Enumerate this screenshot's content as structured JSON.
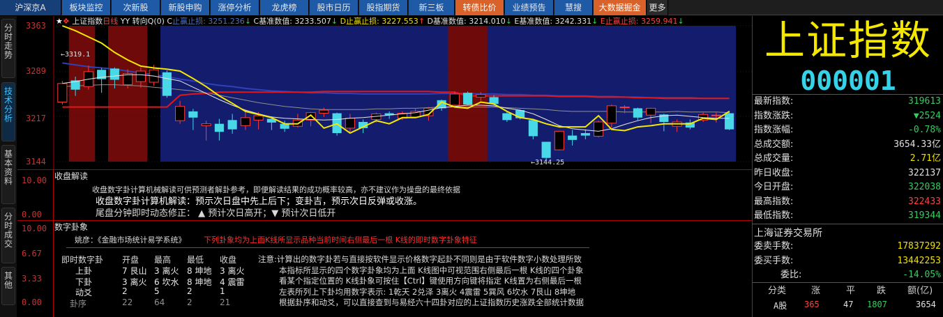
{
  "topbar": {
    "tabs": [
      {
        "label": "沪深京A",
        "style": "first"
      },
      {
        "label": "板块监控",
        "style": ""
      },
      {
        "label": "次新股",
        "style": ""
      },
      {
        "label": "新股申购",
        "style": ""
      },
      {
        "label": "涨停分析",
        "style": ""
      },
      {
        "label": "龙虎榜",
        "style": ""
      },
      {
        "label": "股市日历",
        "style": ""
      },
      {
        "label": "股指期货",
        "style": ""
      },
      {
        "label": "新三板",
        "style": ""
      },
      {
        "label": "转债比价",
        "style": "orange"
      },
      {
        "label": "业绩预告",
        "style": ""
      },
      {
        "label": "慧搜",
        "style": ""
      },
      {
        "label": "大数据掘金",
        "style": "orange"
      },
      {
        "label": "更多",
        "style": "more"
      }
    ]
  },
  "leftbar": {
    "tabs": [
      "分时走势",
      "技术分析",
      "基本资料",
      "分时成交",
      "其他"
    ],
    "active_index": 1
  },
  "kline": {
    "legend": [
      {
        "text": "★",
        "color": "#ffffff"
      },
      {
        "text": "❖",
        "color": "#ff3030"
      },
      {
        "text": " 上证指数",
        "color": "#e0e0e0"
      },
      {
        "text": "日线",
        "color": "#ff4040"
      },
      {
        "text": " YY 转向Q(0) ",
        "color": "#e0e0e0"
      },
      {
        "text": "C",
        "color": "#e0e0e0"
      },
      {
        "text": "止赢止损: 3251.236",
        "color": "#4a74c8"
      },
      {
        "text": "↓",
        "color": "#30d060"
      },
      {
        "text": " C",
        "color": "#e0e0e0"
      },
      {
        "text": "基准数值: 3233.507",
        "color": "#e0e0e0"
      },
      {
        "text": "↓",
        "color": "#30d060"
      },
      {
        "text": " D",
        "color": "#f0e000"
      },
      {
        "text": "止赢止损: 3227.553",
        "color": "#f0e000"
      },
      {
        "text": "↑",
        "color": "#ff4040"
      },
      {
        "text": " D",
        "color": "#e0e0e0"
      },
      {
        "text": "基准数值: 3214.010",
        "color": "#e0e0e0"
      },
      {
        "text": "↓",
        "color": "#30d060"
      },
      {
        "text": " E",
        "color": "#e0e0e0"
      },
      {
        "text": "基准数值: 3242.331",
        "color": "#e0e0e0"
      },
      {
        "text": "↓",
        "color": "#30d060"
      },
      {
        "text": " E",
        "color": "#ff4040"
      },
      {
        "text": "止赢止损: 3259.941",
        "color": "#ff4040"
      },
      {
        "text": "↓",
        "color": "#30d060"
      }
    ],
    "y_labels": [
      "3363",
      "3289",
      "3217",
      "3144"
    ],
    "annotations": {
      "high": "←3319.1",
      "low": "←3144.25"
    }
  },
  "chart_data": {
    "type": "candlestick",
    "ylim": [
      3144,
      3363
    ],
    "candles": [
      {
        "o": 3240,
        "c": 3270,
        "h": 3274,
        "l": 3236
      },
      {
        "o": 3275,
        "c": 3260,
        "h": 3281,
        "l": 3250
      },
      {
        "o": 3265,
        "c": 3289,
        "h": 3299,
        "l": 3260
      },
      {
        "o": 3292,
        "c": 3277,
        "h": 3295,
        "l": 3255
      },
      {
        "o": 3294,
        "c": 3276,
        "h": 3296,
        "l": 3262
      },
      {
        "o": 3268,
        "c": 3286,
        "h": 3293,
        "l": 3262
      },
      {
        "o": 3273,
        "c": 3290,
        "h": 3296,
        "l": 3263
      },
      {
        "o": 3272,
        "c": 3292,
        "h": 3300,
        "l": 3266
      },
      {
        "o": 3288,
        "c": 3250,
        "h": 3291,
        "l": 3247
      },
      {
        "o": 3210,
        "c": 3233,
        "h": 3242,
        "l": 3205
      },
      {
        "o": 3225,
        "c": 3215,
        "h": 3229,
        "l": 3195
      },
      {
        "o": 3202,
        "c": 3205,
        "h": 3210,
        "l": 3178
      },
      {
        "o": 3205,
        "c": 3192,
        "h": 3213,
        "l": 3178
      },
      {
        "o": 3211,
        "c": 3196,
        "h": 3221,
        "l": 3189
      },
      {
        "o": 3202,
        "c": 3215,
        "h": 3228,
        "l": 3195
      },
      {
        "o": 3211,
        "c": 3218,
        "h": 3224,
        "l": 3196
      },
      {
        "o": 3213,
        "c": 3207,
        "h": 3217,
        "l": 3195
      },
      {
        "o": 3205,
        "c": 3197,
        "h": 3210,
        "l": 3192
      },
      {
        "o": 3201,
        "c": 3211,
        "h": 3221,
        "l": 3199
      },
      {
        "o": 3211,
        "c": 3223,
        "h": 3224,
        "l": 3201
      },
      {
        "o": 3222,
        "c": 3227,
        "h": 3231,
        "l": 3216
      },
      {
        "o": 3222,
        "c": 3190,
        "h": 3223,
        "l": 3186
      },
      {
        "o": 3198,
        "c": 3214,
        "h": 3221,
        "l": 3189
      },
      {
        "o": 3208,
        "c": 3198,
        "h": 3212,
        "l": 3190
      },
      {
        "o": 3212,
        "c": 3221,
        "h": 3223,
        "l": 3207
      },
      {
        "o": 3222,
        "c": 3219,
        "h": 3225,
        "l": 3213
      },
      {
        "o": 3214,
        "c": 3222,
        "h": 3225,
        "l": 3211
      },
      {
        "o": 3216,
        "c": 3225,
        "h": 3229,
        "l": 3216
      },
      {
        "o": 3218,
        "c": 3230,
        "h": 3232,
        "l": 3210
      },
      {
        "o": 3243,
        "c": 3230,
        "h": 3244,
        "l": 3226
      },
      {
        "o": 3235,
        "c": 3253,
        "h": 3257,
        "l": 3233
      },
      {
        "o": 3255,
        "c": 3236,
        "h": 3257,
        "l": 3235
      },
      {
        "o": 3248,
        "c": 3252,
        "h": 3256,
        "l": 3242
      },
      {
        "o": 3248,
        "c": 3237,
        "h": 3251,
        "l": 3235
      },
      {
        "o": 3222,
        "c": 3211,
        "h": 3224,
        "l": 3208
      },
      {
        "o": 3227,
        "c": 3214,
        "h": 3228,
        "l": 3212
      },
      {
        "o": 3211,
        "c": 3185,
        "h": 3213,
        "l": 3180
      },
      {
        "o": 3176,
        "c": 3150,
        "h": 3176,
        "l": 3144
      },
      {
        "o": 3163,
        "c": 3193,
        "h": 3194,
        "l": 3162
      },
      {
        "o": 3186,
        "c": 3179,
        "h": 3195,
        "l": 3170
      },
      {
        "o": 3190,
        "c": 3186,
        "h": 3196,
        "l": 3180
      },
      {
        "o": 3185,
        "c": 3208,
        "h": 3210,
        "l": 3183
      },
      {
        "o": 3206,
        "c": 3234,
        "h": 3236,
        "l": 3199
      },
      {
        "o": 3231,
        "c": 3232,
        "h": 3235,
        "l": 3222
      },
      {
        "o": 3230,
        "c": 3215,
        "h": 3231,
        "l": 3211
      },
      {
        "o": 3219,
        "c": 3230,
        "h": 3231,
        "l": 3206
      },
      {
        "o": 3220,
        "c": 3208,
        "h": 3221,
        "l": 3193
      },
      {
        "o": 3201,
        "c": 3208,
        "h": 3212,
        "l": 3192
      },
      {
        "o": 3207,
        "c": 3199,
        "h": 3212,
        "l": 3196
      },
      {
        "o": 3211,
        "c": 3220,
        "h": 3223,
        "l": 3208
      },
      {
        "o": 3219,
        "c": 3219,
        "h": 3223,
        "l": 3207
      },
      {
        "o": 3222,
        "c": 3196,
        "h": 3226,
        "l": 3195
      }
    ],
    "red_line": [
      3232,
      3232,
      3232,
      3232,
      3232,
      3232,
      3232,
      3232,
      3232,
      3251,
      3253,
      3254,
      3256,
      3256,
      3256,
      3256,
      3256,
      3256,
      3256,
      3256,
      3257,
      3257,
      3257,
      3257,
      3257,
      3257,
      3257,
      3257,
      3257,
      3256,
      3256,
      3250,
      3250,
      3250,
      3250,
      3250,
      3250,
      3250,
      3249,
      3249,
      3249,
      3248,
      3248,
      3248,
      3247,
      3247,
      3246,
      3246,
      3246,
      3246,
      3246,
      3246
    ],
    "yellow_line": [
      3363,
      3355,
      3345,
      3335,
      3320,
      3308,
      3298,
      3295,
      3293,
      3290,
      3278,
      3265,
      3250,
      3238,
      3225,
      3220,
      3215,
      3205,
      3205,
      3219,
      3198,
      3205,
      3190,
      3200,
      3210,
      3205,
      3215,
      3215,
      3220,
      3240,
      3232,
      3230,
      3240,
      3237,
      3225,
      3215,
      3212,
      3205,
      3200,
      3200,
      3200,
      3218,
      3196,
      3194,
      3200,
      3202,
      3205,
      3205,
      3205,
      3214,
      3212,
      3225
    ],
    "navy_line": [
      3303,
      3300,
      3297,
      3295,
      3293,
      3290,
      3287,
      3284,
      3281,
      3277,
      3274,
      3270,
      3267,
      3265,
      3262,
      3260,
      3258,
      3257,
      3256,
      3255,
      3255,
      3254,
      3254,
      3253,
      3253,
      3253,
      3253,
      3253,
      3253,
      3254,
      3254,
      3254,
      3253,
      3253,
      3252,
      3252,
      3251,
      3251,
      3250,
      3250,
      3250,
      3249,
      3249,
      3248,
      3248,
      3247,
      3247,
      3247,
      3247,
      3246,
      3246,
      3246
    ],
    "white_line": [
      3270,
      3273,
      3277,
      3280,
      3282,
      3284,
      3284,
      3282,
      3278,
      3274,
      3264,
      3254,
      3244,
      3235,
      3227,
      3221,
      3216,
      3214,
      3213,
      3212,
      3211,
      3212,
      3214,
      3215,
      3217,
      3219,
      3221,
      3223,
      3227,
      3231,
      3233,
      3235,
      3235,
      3234,
      3230,
      3227,
      3221,
      3212,
      3202,
      3197,
      3195,
      3193,
      3197,
      3204,
      3210,
      3215,
      3218,
      3219,
      3217,
      3215,
      3214,
      3214
    ],
    "gray_line": [
      3265,
      3266,
      3267,
      3268,
      3268,
      3267,
      3266,
      3264,
      3262,
      3260,
      3258,
      3255,
      3251,
      3247,
      3243,
      3239,
      3236,
      3233,
      3231,
      3229,
      3228,
      3228,
      3228,
      3228,
      3229,
      3229,
      3230,
      3230,
      3231,
      3232,
      3232,
      3232,
      3232,
      3232,
      3231,
      3230,
      3229,
      3228,
      3226,
      3225,
      3225,
      3225,
      3225,
      3224,
      3224,
      3224,
      3224,
      3225,
      3224,
      3224,
      3224,
      3223
    ],
    "red_bands": [
      [
        1,
        2
      ],
      [
        4,
        6
      ],
      [
        30,
        32
      ]
    ],
    "navy_from": 8
  },
  "panel2": {
    "title": "收盘解读",
    "axis": [
      "10.00",
      "0.00"
    ],
    "line1": "收盘数字卦计算机械解读可供预测者解卦参考，即便解读结果的成功概率较高，亦不建议作为操盘的最终依据",
    "line2": "收盘数字卦计算机解读：预示次日盘中先上后下；变卦吉，预示次日反弹或收涨。",
    "line3": "尾盘分钟即时动态修正： ▲ 预计次日高开；▼ 预计次日低开"
  },
  "panel3": {
    "title": "数字卦象",
    "axis": [
      "10.00",
      "6.67",
      "3.33",
      "0.00"
    ],
    "yao_label": "姚彦：《金融市场统计易学系统》",
    "yao_red": "下列卦象均为上面K线所显示品种当前时间右侧最后一根 K线的即时数字卦象特征",
    "headers": [
      "即时数字卦",
      "开盘",
      "最高",
      "最低",
      "收盘"
    ],
    "rows": [
      {
        "name": "上卦",
        "c1": "7 艮山",
        "c2": "3 离火",
        "c3": "8 坤地",
        "c4": "3 离火"
      },
      {
        "name": "下卦",
        "c1": "3 离火",
        "c2": "6 坎水",
        "c3": "8 坤地",
        "c4": "4 震雷"
      },
      {
        "name": "动爻",
        "c1": "2",
        "c2": "5",
        "c3": "2",
        "c4": "1"
      },
      {
        "name": "卦序",
        "c1": "22",
        "c2": "64",
        "c3": "2",
        "c4": "21"
      }
    ],
    "notes": [
      "注意:计算出的数字卦若与直接按软件显示价格数字起卦不同则是由于软件数字小数处理所致",
      "本指标所显示的四个数字卦象均为上面 K线图中可视范围右侧最后一根 K线的四个卦象",
      "看某个指定位置的 K线卦象可按住【Ctrl】键使用方向键将指定 K线置为右侧最后一根",
      "左表所列上下卦均用数字表示: 1乾天 2兑泽 3离火 4震雷 5巽风 6坎水 7艮山 8坤地",
      "根据卦序和动爻，可以直接查到与易经六十四卦对应的上证指数历史涨跌全部统计数据"
    ]
  },
  "right": {
    "name": "上证指数",
    "code": "000001",
    "quotes": [
      {
        "label": "最新指数:",
        "value": "319613",
        "color": "#30d060"
      },
      {
        "label": "指数涨跌:",
        "value": "▼2524",
        "color": "#30d060"
      },
      {
        "label": "指数涨幅:",
        "value": "-0.78%",
        "color": "#30d060"
      },
      {
        "label": "总成交额:",
        "value": "3654.33亿",
        "color": "#e0e0e0"
      },
      {
        "label": "总成交量:",
        "value": "2.71亿",
        "color": "#f0e000"
      },
      {
        "label": "昨日收盘:",
        "value": "322137",
        "color": "#e0e0e0"
      },
      {
        "label": "今日开盘:",
        "value": "322038",
        "color": "#30d060"
      },
      {
        "label": "最高指数:",
        "value": "322433",
        "color": "#ff4040"
      },
      {
        "label": "最低指数:",
        "value": "319344",
        "color": "#30d060"
      }
    ],
    "exchange": "上海证券交易所",
    "orders": [
      {
        "label": "委卖手数:",
        "value": "17837292",
        "color": "#f0e000"
      },
      {
        "label": "委买手数:",
        "value": "13442253",
        "color": "#f0e000"
      },
      {
        "label": "委比:",
        "value": "-14.05%",
        "color": "#30d060"
      }
    ],
    "table": {
      "headers": [
        "分类",
        "涨",
        "平",
        "跌",
        "额(亿)"
      ],
      "row": {
        "name": "A股",
        "up": "365",
        "flat": "47",
        "down": "1807",
        "amount": "3654"
      }
    }
  }
}
